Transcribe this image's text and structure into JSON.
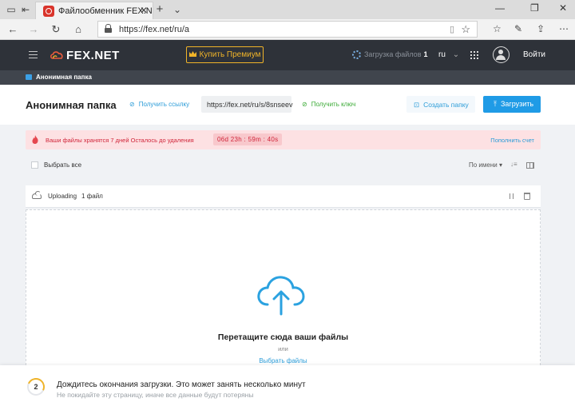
{
  "browser": {
    "tab_title": "Файлообменник FEX.N",
    "url": "https://fex.net/ru/a",
    "window_minimize": "—",
    "window_restore": "❐",
    "window_close": "✕"
  },
  "header": {
    "logo_text": "FEX.NET",
    "premium_label": "Купить Премиум",
    "uploading_label": "Загрузка файлов",
    "uploading_count": "1",
    "language": "ru",
    "login_label": "Войти"
  },
  "breadcrumb": {
    "label": "Анонимная папка"
  },
  "toolbar": {
    "folder_title": "Анонимная папка",
    "get_link_label": "Получить ссылку",
    "share_link": "https://fex.net/ru/s/8snseev",
    "get_key_label": "Получить ключ",
    "create_folder_label": "Создать папку",
    "upload_label": "Загрузить"
  },
  "alert": {
    "message": "Ваши файлы хранятся 7 дней Осталось до удаления",
    "timer": "06d  23h : 59m : 40s",
    "topup_label": "Пополнить счет"
  },
  "list": {
    "select_all_label": "Выбрать все",
    "sort_label": "По имени ▾",
    "sort_dir": "↓≡"
  },
  "upload_status": {
    "status": "Uploading",
    "count": "1 файл"
  },
  "dropzone": {
    "title": "Перетащите сюда ваши файлы",
    "or": "или",
    "choose_label": "Выбрать файлы"
  },
  "notification": {
    "step": "2",
    "heading": "Дождитесь окончания загрузки. Это может занять несколько минут",
    "subtext": "Не покидайте эту страницу, иначе все данные будут потеряны"
  },
  "colors": {
    "header_bg": "#2e3239",
    "accent_blue": "#1f9be6",
    "premium_gold": "#f0b429",
    "alert_red": "#d0253a",
    "key_green": "#3aaa35"
  }
}
